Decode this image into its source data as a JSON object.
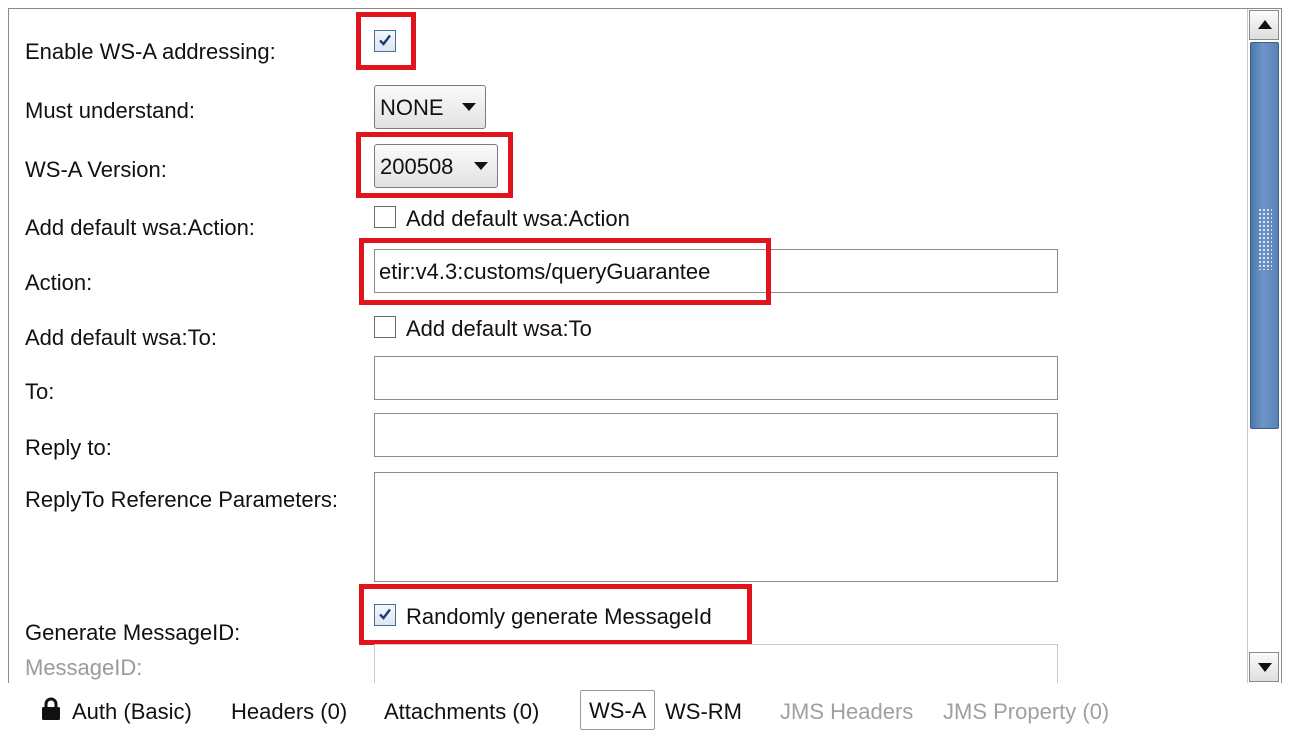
{
  "form": {
    "enable_wsa_label": "Enable WS-A addressing:",
    "enable_wsa_checked": true,
    "must_understand_label": "Must understand:",
    "must_understand_value": "NONE",
    "wsa_version_label": "WS-A Version:",
    "wsa_version_value": "200508",
    "add_default_action_label": "Add default wsa:Action:",
    "add_default_action_cb_text": "Add default wsa:Action",
    "add_default_action_checked": false,
    "action_label": "Action:",
    "action_value": "etir:v4.3:customs/queryGuarantee",
    "add_default_to_label": "Add default wsa:To:",
    "add_default_to_cb_text": "Add default wsa:To",
    "add_default_to_checked": false,
    "to_label": "To:",
    "to_value": "",
    "reply_to_label": "Reply to:",
    "reply_to_value": "",
    "replyto_ref_params_label": "ReplyTo Reference Parameters:",
    "replyto_ref_params_value": "",
    "generate_messageid_label": "Generate MessageID:",
    "generate_messageid_cb_text": "Randomly generate MessageId",
    "generate_messageid_checked": true,
    "messageid_label": "MessageID:",
    "messageid_value": ""
  },
  "tabs": [
    {
      "label": "Auth (Basic)",
      "icon": "lock-icon",
      "state": "normal"
    },
    {
      "label": "Headers (0)",
      "state": "normal"
    },
    {
      "label": "Attachments (0)",
      "state": "normal"
    },
    {
      "label": "WS-A",
      "state": "selected"
    },
    {
      "label": "WS-RM",
      "state": "normal"
    },
    {
      "label": "JMS Headers",
      "state": "disabled"
    },
    {
      "label": "JMS Property (0)",
      "state": "disabled"
    }
  ],
  "colors": {
    "highlight": "#e0141c",
    "scrollbar_thumb": "#5a82b7",
    "disabled_text": "#9a9a9a"
  }
}
